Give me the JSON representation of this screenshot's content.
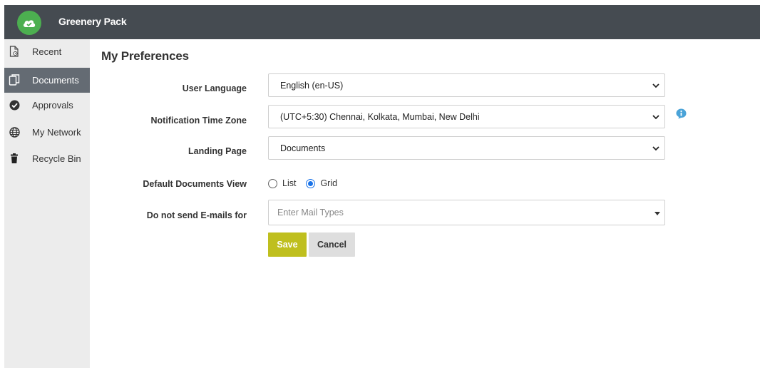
{
  "app": {
    "title": "Greenery Pack",
    "logo_icon": "cloud-check-icon",
    "accent": "#4caf50"
  },
  "sidebar": {
    "items": [
      {
        "label": "Recent",
        "icon": "recent-file-icon",
        "active": false
      },
      {
        "label": "Documents",
        "icon": "documents-icon",
        "active": true
      },
      {
        "label": "Approvals",
        "icon": "check-circle-icon",
        "active": false
      },
      {
        "label": "My Network",
        "icon": "globe-icon",
        "active": false
      },
      {
        "label": "Recycle Bin",
        "icon": "trash-icon",
        "active": false
      }
    ]
  },
  "main": {
    "title": "My Preferences",
    "fields": {
      "language": {
        "label": "User Language",
        "value": "English (en-US)"
      },
      "timezone": {
        "label": "Notification Time Zone",
        "value": "(UTC+5:30) Chennai, Kolkata, Mumbai, New Delhi",
        "info_icon": "info-icon"
      },
      "landing": {
        "label": "Landing Page",
        "value": "Documents"
      },
      "view": {
        "label": "Default Documents View",
        "options": [
          "List",
          "Grid"
        ],
        "selected": "Grid"
      },
      "emails": {
        "label": "Do not send E-mails for",
        "placeholder": "Enter Mail Types"
      }
    },
    "buttons": {
      "save": "Save",
      "cancel": "Cancel"
    }
  },
  "colors": {
    "header": "#454b51",
    "sidebar": "#ececec",
    "active": "#646b73",
    "save": "#bfbf1e",
    "cancel": "#dedede",
    "radio": "#1a73e8"
  }
}
